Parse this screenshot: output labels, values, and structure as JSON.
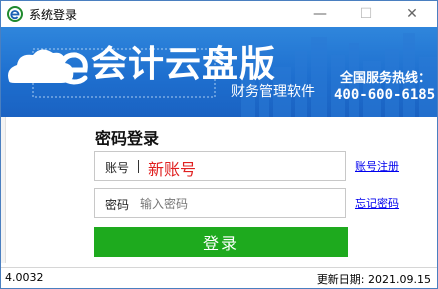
{
  "window": {
    "title": "系统登录",
    "icon": "e-logo-icon",
    "controls": {
      "minimize": "—",
      "maximize": "☐",
      "close": "✕"
    }
  },
  "banner": {
    "logo_text": "会计云盘版",
    "subtitle": "财务管理软件",
    "hotline_label": "全国服务热线：",
    "hotline_number": "400-600-6185",
    "colors": {
      "background": "#1e6fcf",
      "text": "#ffffff"
    }
  },
  "login": {
    "title": "密码登录",
    "account_label": "账号",
    "account_value": "新账号",
    "password_label": "密码",
    "password_placeholder": "输入密码",
    "register_link": "账号注册",
    "forgot_link": "忘记密码",
    "submit_label": "登录",
    "colors": {
      "submit": "#1eaa1e",
      "account_value": "#e02020",
      "link": "#0000ee"
    }
  },
  "statusbar": {
    "version": "4.0032",
    "update_date": "更新日期: 2021.09.15"
  }
}
